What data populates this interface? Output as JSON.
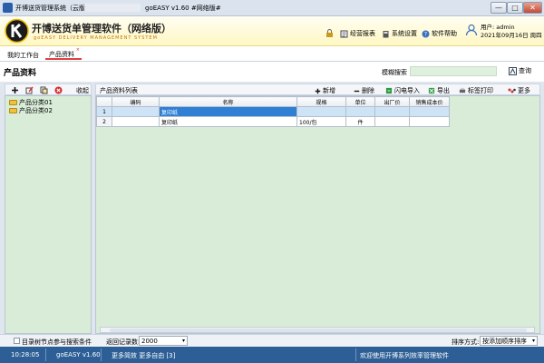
{
  "window": {
    "title": "开博送货管理系统（云版）",
    "version_text": "goEASY v1.60  #网络版#",
    "controls": {
      "minimize": "—",
      "maximize": "□",
      "close": "✕"
    }
  },
  "header": {
    "app_name": "开博送货单管理软件（网络版）",
    "subtitle": "goEASY DELIVERY MANAGEMENT SYSTEM",
    "links": [
      {
        "label": "经营报表",
        "icon": "report-icon"
      },
      {
        "label": "系统设置",
        "icon": "settings-icon"
      },
      {
        "label": "软件帮助",
        "icon": "help-icon"
      }
    ],
    "user_label": "用户: admin",
    "date_label": "2021年09月16日 周四"
  },
  "tabs": {
    "home": "我的工作台",
    "product": "产品资料",
    "close": "×"
  },
  "page": {
    "title": "产品资料",
    "search_label": "模糊搜索",
    "search_value": "",
    "query_label": "查询"
  },
  "left_panel": {
    "collapse_label": "收起",
    "tree": [
      "产品分类01",
      "产品分类02"
    ]
  },
  "grid_toolbar": {
    "title": "产品资料列表",
    "add": "新增",
    "delete": "删除",
    "import": "闪电导入",
    "export": "导出",
    "print": "标签打印",
    "more": "更多"
  },
  "grid": {
    "columns": [
      "",
      "编码",
      "名称",
      "规格",
      "单位",
      "出厂价",
      "销售成本价"
    ],
    "rows": [
      [
        "1",
        "",
        "复印纸",
        "",
        "",
        "",
        ""
      ],
      [
        "2",
        "",
        "复印纸",
        "100/包",
        "件",
        "",
        ""
      ]
    ]
  },
  "bottom": {
    "checkbox_label": "目录树节点参与搜索条件",
    "records_label": "返回记录数:",
    "records_value": "2000",
    "sort_label": "排序方式:",
    "sort_value": "按添加顺序排序",
    "dropdown_arrow": "▾"
  },
  "status": {
    "time": "10:28:05",
    "version": "goEASY v1.60",
    "links": "更多简效 更多自由 [3]",
    "welcome": "欢迎使用开博系列效率管理软件"
  },
  "colors": {
    "accent": "#2f7fd4",
    "status_bar": "#2d5f96",
    "grid_bg": "#d8ecd8",
    "header_bg": "#fff7c4"
  }
}
